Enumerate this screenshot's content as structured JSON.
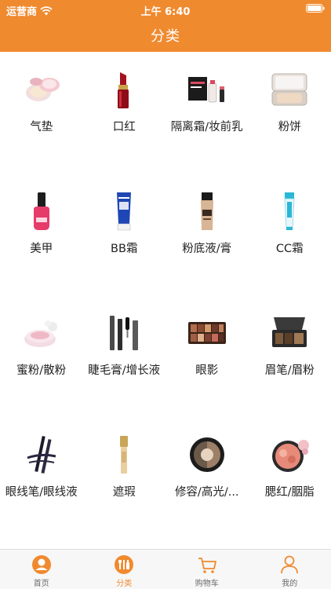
{
  "status": {
    "carrier": "运营商",
    "time": "上午 6:40"
  },
  "header": {
    "title": "分类"
  },
  "colors": {
    "accent": "#f08a2f",
    "tab_inactive": "#6b6b6b"
  },
  "categories": [
    {
      "label": "气垫",
      "icon": "cushion-icon"
    },
    {
      "label": "口红",
      "icon": "lipstick-icon"
    },
    {
      "label": "隔离霜/妆前乳",
      "icon": "primer-icon"
    },
    {
      "label": "粉饼",
      "icon": "pressed-powder-icon"
    },
    {
      "label": "美甲",
      "icon": "nail-polish-icon"
    },
    {
      "label": "BB霜",
      "icon": "bb-cream-icon"
    },
    {
      "label": "粉底液/膏",
      "icon": "foundation-icon"
    },
    {
      "label": "CC霜",
      "icon": "cc-cream-icon"
    },
    {
      "label": "蜜粉/散粉",
      "icon": "loose-powder-icon"
    },
    {
      "label": "睫毛膏/增长液",
      "icon": "mascara-icon"
    },
    {
      "label": "眼影",
      "icon": "eyeshadow-icon"
    },
    {
      "label": "眉笔/眉粉",
      "icon": "brow-palette-icon"
    },
    {
      "label": "眼线笔/眼线液",
      "icon": "eyeliner-icon"
    },
    {
      "label": "遮瑕",
      "icon": "concealer-icon"
    },
    {
      "label": "修容/高光/...",
      "icon": "contour-icon"
    },
    {
      "label": "腮红/胭脂",
      "icon": "blush-icon"
    }
  ],
  "tabbar": {
    "tabs": [
      {
        "label": "首页",
        "icon": "home-icon"
      },
      {
        "label": "分类",
        "icon": "category-icon",
        "active": true
      },
      {
        "label": "购物车",
        "icon": "cart-icon"
      },
      {
        "label": "我的",
        "icon": "profile-icon"
      }
    ]
  }
}
